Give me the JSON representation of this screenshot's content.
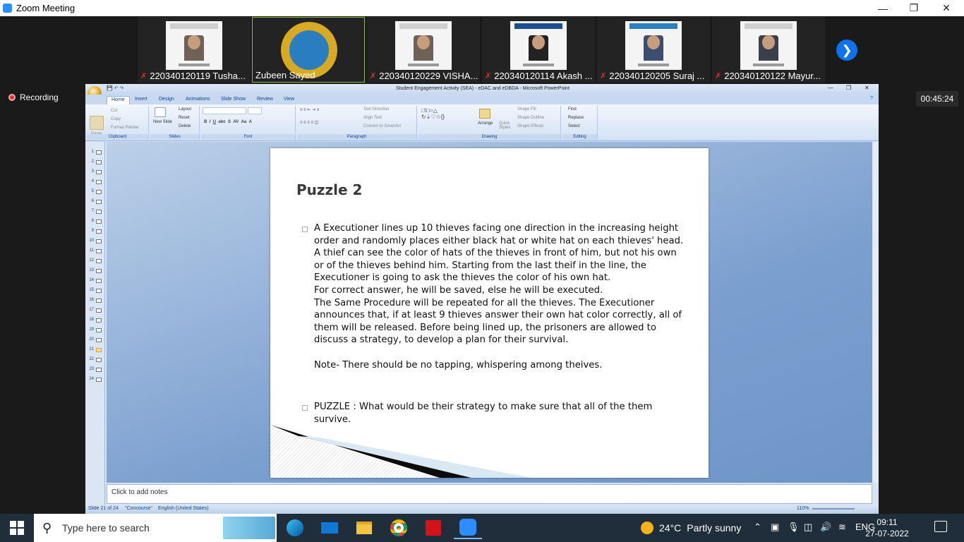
{
  "zoom": {
    "window_title": "Zoom Meeting",
    "recording_label": "Recording",
    "timer": "00:45:24",
    "participants": [
      {
        "name": "220340120119 Tusha...",
        "muted": true
      },
      {
        "name": "Zubeen Sayed",
        "muted": false
      },
      {
        "name": "220340120229 VISHA...",
        "muted": true
      },
      {
        "name": "220340120114 Akash ...",
        "muted": true
      },
      {
        "name": "220340120205 Suraj ...",
        "muted": true
      },
      {
        "name": "220340120122 Mayur...",
        "muted": true
      }
    ],
    "next_icon": "chevron-right-icon"
  },
  "ppt": {
    "window_title": "Student Engagement Activity (SEA) - eDAC and eDBDA - Microsoft PowerPoint",
    "tabs": [
      "Home",
      "Insert",
      "Design",
      "Animations",
      "Slide Show",
      "Review",
      "View"
    ],
    "ribbon": {
      "groups": [
        "Clipboard",
        "Slides",
        "Font",
        "Paragraph",
        "Drawing",
        "Editing"
      ],
      "clipboard": {
        "paste": "Paste",
        "cut": "Cut",
        "copy": "Copy",
        "format_painter": "Format Painter"
      },
      "slides": {
        "new_slide": "New Slide",
        "layout": "Layout",
        "reset": "Reset",
        "delete": "Delete"
      },
      "paragraph": {
        "text_direction": "Text Direction",
        "align_text": "Align Text",
        "convert": "Convert to SmartArt"
      },
      "drawing": {
        "arrange": "Arrange",
        "quick_styles": "Quick Styles",
        "shape_fill": "Shape Fill",
        "shape_outline": "Shape Outline",
        "shape_effects": "Shape Effects"
      },
      "editing": {
        "find": "Find",
        "replace": "Replace",
        "select": "Select"
      }
    },
    "slide_numbers": [
      "1",
      "2",
      "3",
      "4",
      "5",
      "6",
      "7",
      "8",
      "9",
      "10",
      "11",
      "12",
      "13",
      "14",
      "15",
      "16",
      "17",
      "18",
      "19",
      "20",
      "21",
      "22",
      "23",
      "24"
    ],
    "current_slide": 21,
    "slide": {
      "title": "Puzzle 2",
      "para1": "A Executioner lines up 10 thieves facing one direction in the increasing height order and randomly places either black hat or white hat on each thieves' head.",
      "para2": "A thief can see the color of hats of the thieves in front of him, but not his own or of the thieves behind him. Starting from the last theif in the line, the Executioner is going to ask the thieves the color of his own hat.",
      "para3": "For correct answer, he will be saved, else he will be executed.",
      "para4": "The Same Procedure will be repeated for all the thieves. The Executioner announces that, if at least 9 thieves answer their own hat color correctly, all of them will be released. Before being lined up, the prisoners are allowed to discuss a strategy, to develop a plan for their survival.",
      "note": "Note- There should be no tapping, whispering among theives.",
      "puzzle": "PUZZLE : What would be their strategy to make sure that all of the them survive."
    },
    "notes_placeholder": "Click to add notes",
    "status": {
      "slide": "Slide 21 of 24",
      "theme": "\"Concourse\"",
      "language": "English (United States)",
      "zoom": "110%"
    }
  },
  "taskbar": {
    "search_placeholder": "Type here to search",
    "apps": [
      "edge-icon",
      "mail-icon",
      "file-explorer-icon",
      "chrome-icon",
      "acrobat-icon",
      "zoom-icon"
    ],
    "weather": {
      "temp": "24°C",
      "condition": "Partly sunny"
    },
    "language": "ENG",
    "time": "09:11",
    "date": "27-07-2022"
  }
}
